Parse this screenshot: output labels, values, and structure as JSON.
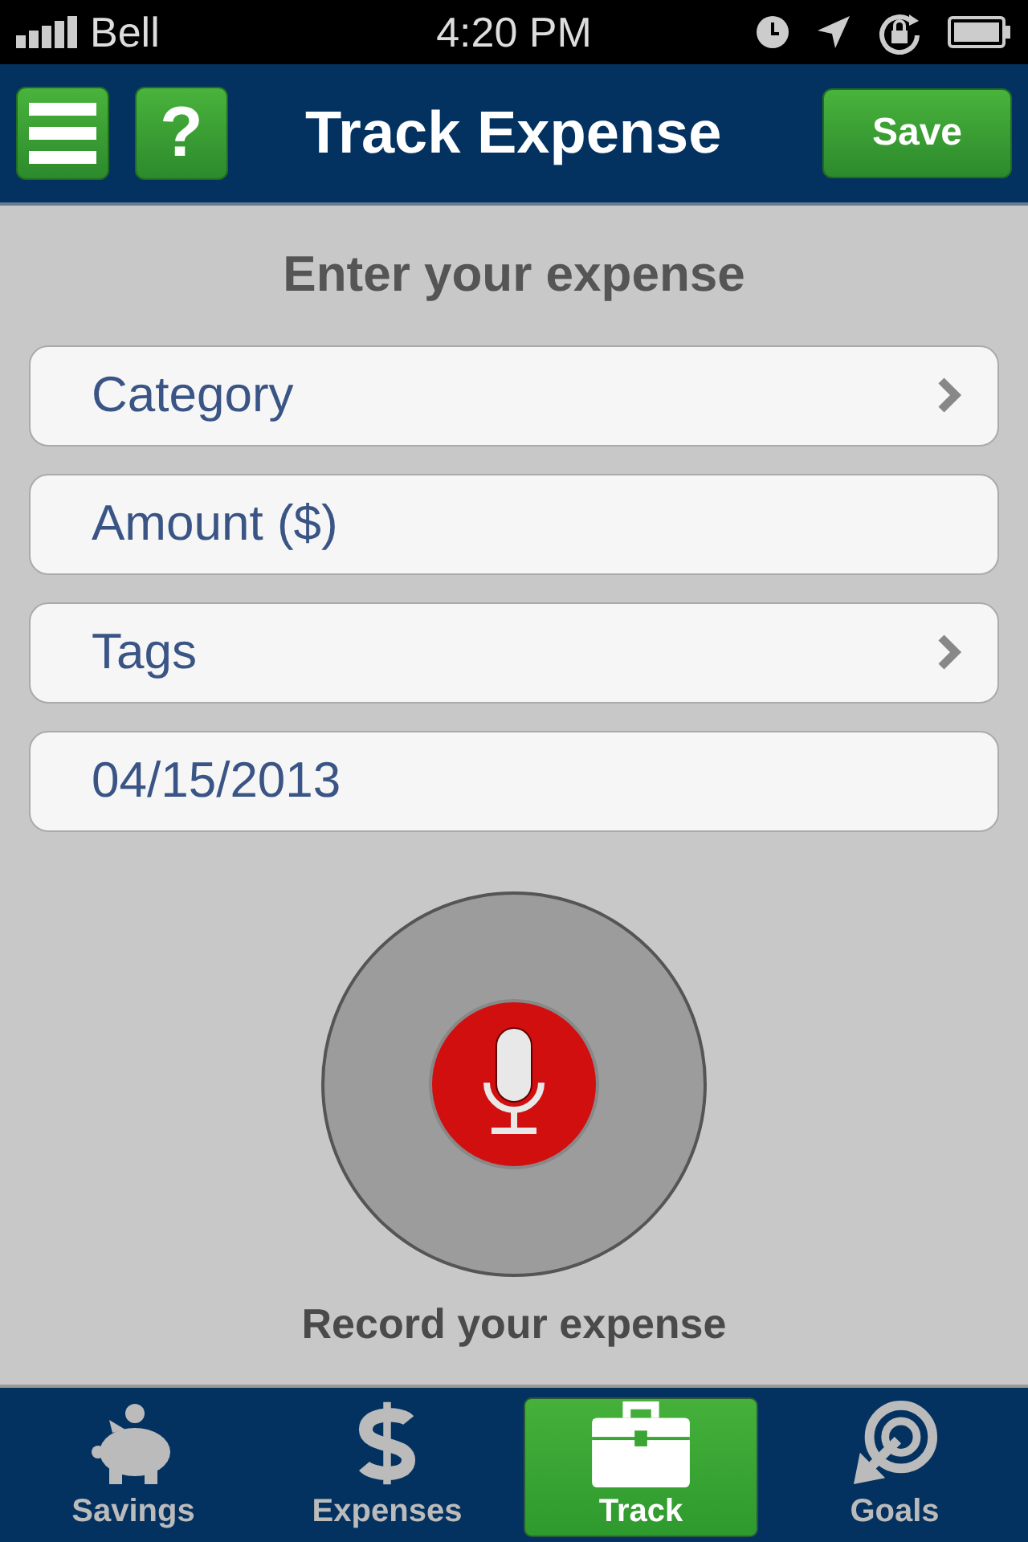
{
  "status_bar": {
    "carrier": "Bell",
    "time": "4:20 PM"
  },
  "header": {
    "title": "Track Expense",
    "save_button": "Save",
    "help_button": "?"
  },
  "form": {
    "heading": "Enter your expense",
    "fields": [
      {
        "kind": "select",
        "label": "Category"
      },
      {
        "kind": "input",
        "placeholder": "Amount ($)"
      },
      {
        "kind": "select",
        "label": "Tags"
      },
      {
        "kind": "input",
        "value": "04/15/2013"
      }
    ]
  },
  "record": {
    "label": "Record your expense"
  },
  "tab_bar": [
    {
      "label": "Savings",
      "selected": false
    },
    {
      "label": "Expenses",
      "selected": false
    },
    {
      "label": "Track",
      "selected": true
    },
    {
      "label": "Goals",
      "selected": false
    }
  ]
}
